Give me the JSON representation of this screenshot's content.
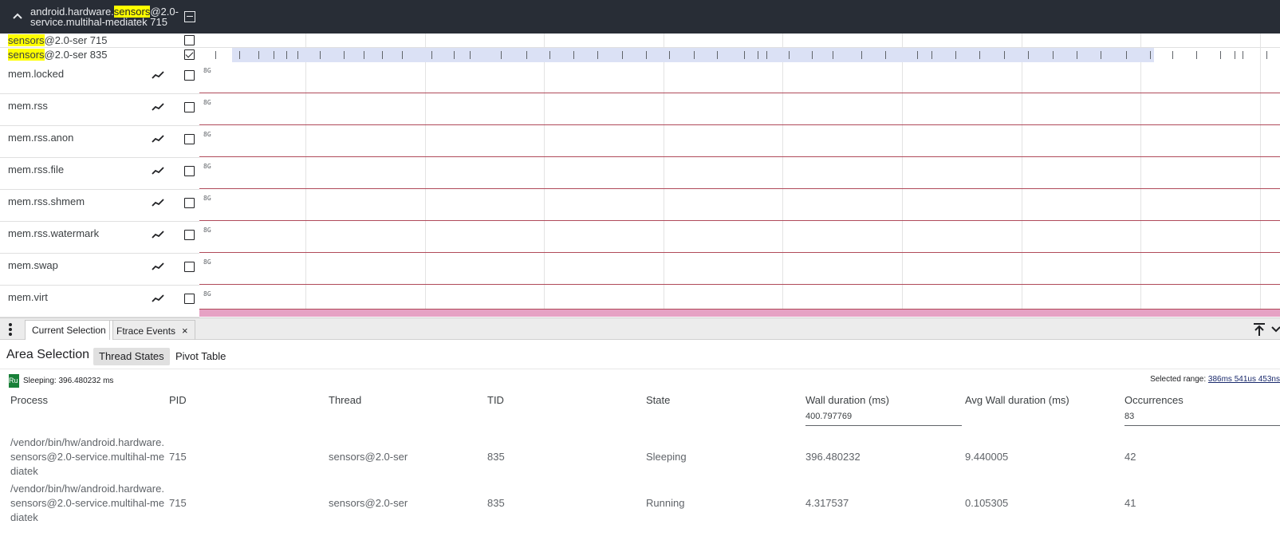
{
  "group": {
    "title_pre": "android.hardware.",
    "title_hl": "sensors",
    "title_post": "@2.0-service.multihal-mediatek 715"
  },
  "threads": [
    {
      "hl": "sensors",
      "rest": "@2.0-ser 715",
      "checked": false
    },
    {
      "hl": "sensors",
      "rest": "@2.0-ser 835",
      "checked": true
    }
  ],
  "counters": [
    {
      "label": "mem.locked",
      "axis": "8G"
    },
    {
      "label": "mem.rss",
      "axis": "8G"
    },
    {
      "label": "mem.rss.anon",
      "axis": "8G"
    },
    {
      "label": "mem.rss.file",
      "axis": "8G"
    },
    {
      "label": "mem.rss.shmem",
      "axis": "8G"
    },
    {
      "label": "mem.rss.watermark",
      "axis": "8G"
    },
    {
      "label": "mem.swap",
      "axis": "8G"
    },
    {
      "label": "mem.virt",
      "axis": "8G"
    }
  ],
  "tabs": {
    "current_selection": "Current Selection",
    "ftrace_events": "Ftrace Events",
    "close_symbol": "×"
  },
  "area": {
    "title": "Area Selection",
    "subtab_thread_states": "Thread States",
    "subtab_pivot_table": "Pivot Table"
  },
  "legend": {
    "swatch_text": "Ru",
    "text": "Sleeping: 396.480232 ms",
    "color": "#188038"
  },
  "selected_range": {
    "label": "Selected range:",
    "value": "386ms 541us 453ns"
  },
  "table": {
    "headers": [
      "Process",
      "PID",
      "Thread",
      "TID",
      "State",
      "Wall duration (ms)",
      "Avg Wall duration (ms)",
      "Occurrences"
    ],
    "totals": {
      "wall": "400.797769",
      "occurrences": "83"
    },
    "rows": [
      {
        "process": "/vendor/bin/hw/android.hardware.sensors@2.0-service.multihal-mediatek",
        "pid": "715",
        "thread": "sensors@2.0-ser",
        "tid": "835",
        "state": "Sleeping",
        "wall": "396.480232",
        "avg": "9.440005",
        "occ": "42"
      },
      {
        "process": "/vendor/bin/hw/android.hardware.sensors@2.0-service.multihal-mediatek",
        "pid": "715",
        "thread": "sensors@2.0-ser",
        "tid": "835",
        "state": "Running",
        "wall": "4.317537",
        "avg": "0.105305",
        "occ": "41"
      }
    ]
  },
  "colors": {
    "header_bg": "#282d36",
    "selection_band": "#dbe1f5",
    "counter_line": "#b04a5a",
    "bottom_band": "#e6a2c4",
    "highlight": "#ffff00"
  }
}
